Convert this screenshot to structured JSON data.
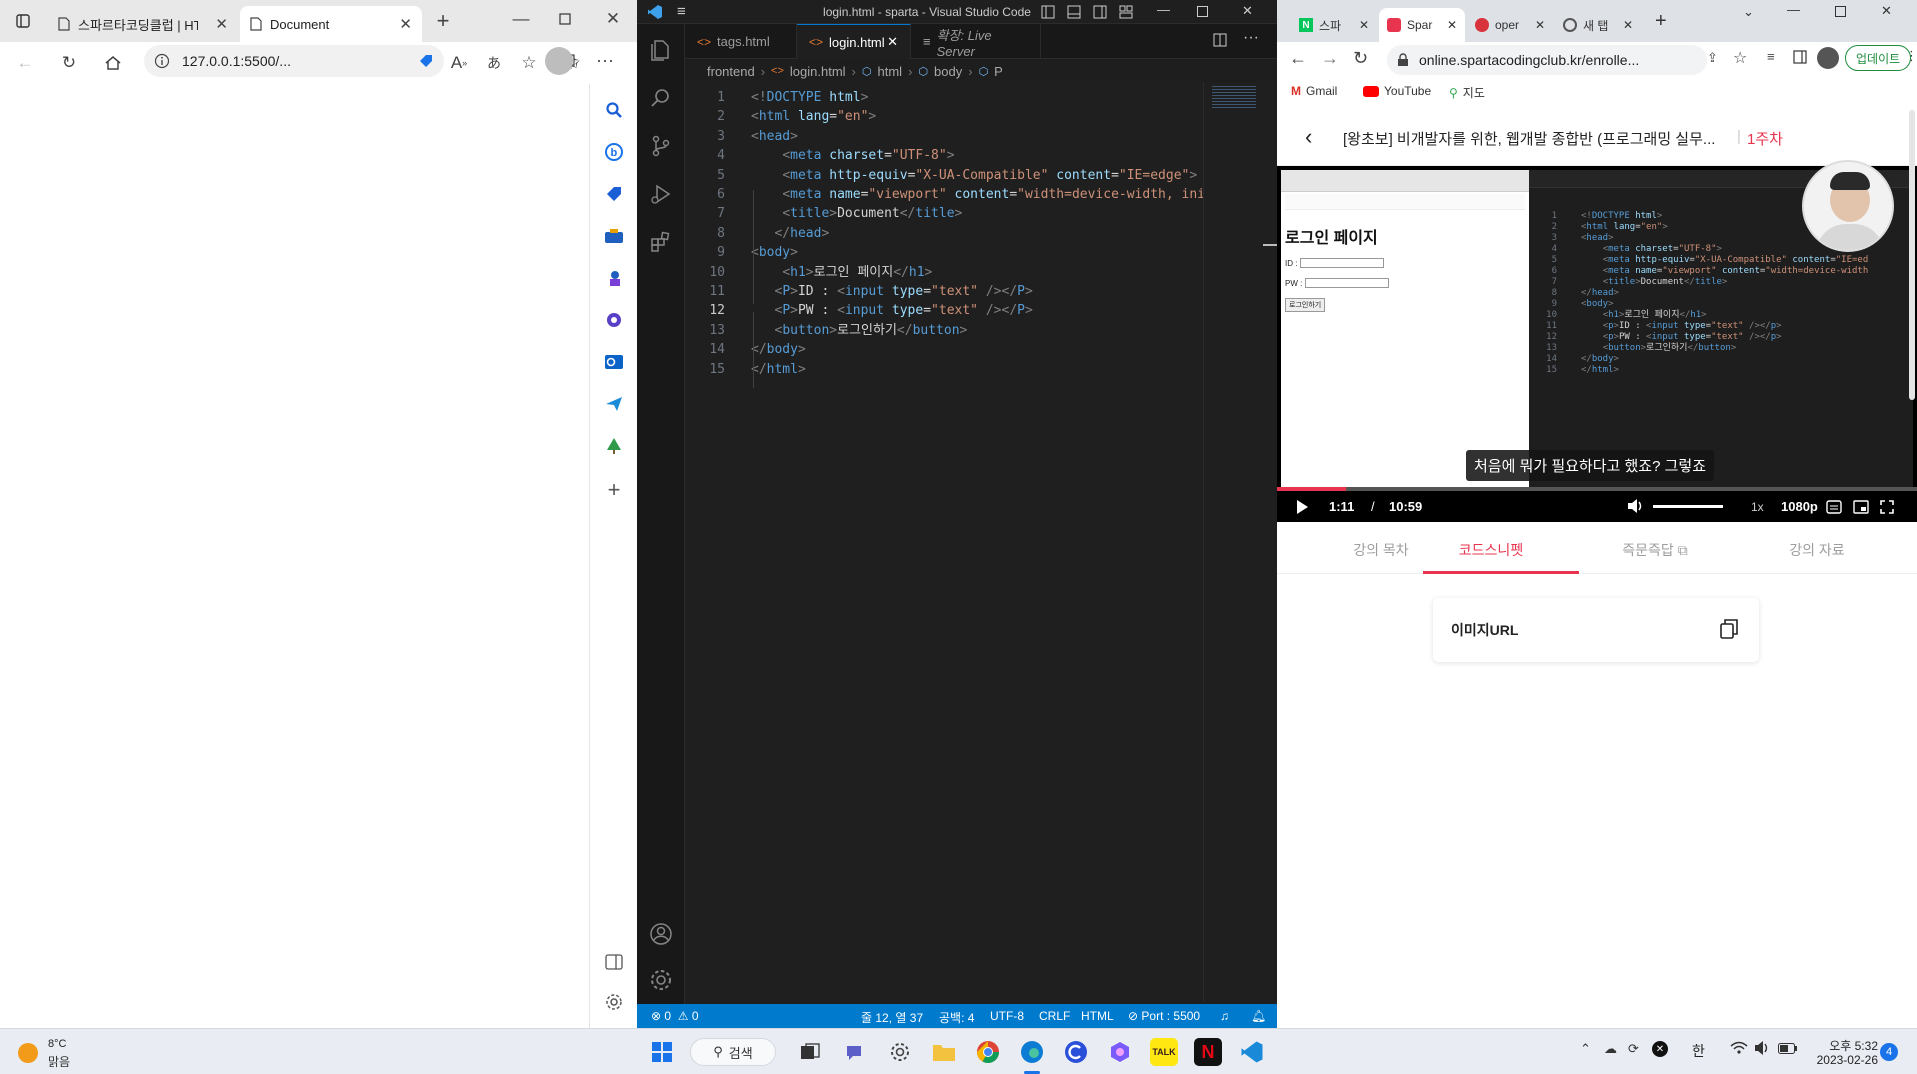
{
  "edge": {
    "tabs": [
      {
        "title": "스파르타코딩클럽 | HT"
      },
      {
        "title": "Document"
      }
    ],
    "address": "127.0.0.1:5500/..."
  },
  "vscode": {
    "title": "login.html - sparta - Visual Studio Code",
    "tabs": [
      {
        "label": "tags.html"
      },
      {
        "label": "login.html"
      },
      {
        "label": "확장: Live Server"
      }
    ],
    "breadcrumb": [
      "frontend",
      "login.html",
      "html",
      "body",
      "P"
    ],
    "current_line": 12,
    "code": [
      [
        {
          "c": "t-pun",
          "t": "<!"
        },
        {
          "c": "t-tag",
          "t": "DOCTYPE"
        },
        {
          "c": "t-txt",
          "t": " "
        },
        {
          "c": "t-attr",
          "t": "html"
        },
        {
          "c": "t-pun",
          "t": ">"
        }
      ],
      [
        {
          "c": "t-pun",
          "t": "<"
        },
        {
          "c": "t-tag",
          "t": "html"
        },
        {
          "c": "t-txt",
          "t": " "
        },
        {
          "c": "t-attr",
          "t": "lang"
        },
        {
          "c": "t-txt",
          "t": "="
        },
        {
          "c": "t-str",
          "t": "\"en\""
        },
        {
          "c": "t-pun",
          "t": ">"
        }
      ],
      [
        {
          "c": "t-pun",
          "t": "<"
        },
        {
          "c": "t-tag",
          "t": "head"
        },
        {
          "c": "t-pun",
          "t": ">"
        }
      ],
      [
        {
          "c": "t-txt",
          "t": "    "
        },
        {
          "c": "t-pun",
          "t": "<"
        },
        {
          "c": "t-tag",
          "t": "meta"
        },
        {
          "c": "t-txt",
          "t": " "
        },
        {
          "c": "t-attr",
          "t": "charset"
        },
        {
          "c": "t-txt",
          "t": "="
        },
        {
          "c": "t-str",
          "t": "\"UTF-8\""
        },
        {
          "c": "t-pun",
          "t": ">"
        }
      ],
      [
        {
          "c": "t-txt",
          "t": "    "
        },
        {
          "c": "t-pun",
          "t": "<"
        },
        {
          "c": "t-tag",
          "t": "meta"
        },
        {
          "c": "t-txt",
          "t": " "
        },
        {
          "c": "t-attr",
          "t": "http-equiv"
        },
        {
          "c": "t-txt",
          "t": "="
        },
        {
          "c": "t-str",
          "t": "\"X-UA-Compatible\""
        },
        {
          "c": "t-txt",
          "t": " "
        },
        {
          "c": "t-attr",
          "t": "content"
        },
        {
          "c": "t-txt",
          "t": "="
        },
        {
          "c": "t-str",
          "t": "\"IE=edge\""
        },
        {
          "c": "t-pun",
          "t": ">"
        }
      ],
      [
        {
          "c": "t-txt",
          "t": "    "
        },
        {
          "c": "t-pun",
          "t": "<"
        },
        {
          "c": "t-tag",
          "t": "meta"
        },
        {
          "c": "t-txt",
          "t": " "
        },
        {
          "c": "t-attr",
          "t": "name"
        },
        {
          "c": "t-txt",
          "t": "="
        },
        {
          "c": "t-str",
          "t": "\"viewport\""
        },
        {
          "c": "t-txt",
          "t": " "
        },
        {
          "c": "t-attr",
          "t": "content"
        },
        {
          "c": "t-txt",
          "t": "="
        },
        {
          "c": "t-str",
          "t": "\"width=device-width, ini"
        }
      ],
      [
        {
          "c": "t-txt",
          "t": "    "
        },
        {
          "c": "t-pun",
          "t": "<"
        },
        {
          "c": "t-tag",
          "t": "title"
        },
        {
          "c": "t-pun",
          "t": ">"
        },
        {
          "c": "t-txt",
          "t": "Document"
        },
        {
          "c": "t-pun",
          "t": "</"
        },
        {
          "c": "t-tag",
          "t": "title"
        },
        {
          "c": "t-pun",
          "t": ">"
        }
      ],
      [
        {
          "c": "t-txt",
          "t": "   "
        },
        {
          "c": "t-pun",
          "t": "</"
        },
        {
          "c": "t-tag",
          "t": "head"
        },
        {
          "c": "t-pun",
          "t": ">"
        }
      ],
      [
        {
          "c": "t-pun",
          "t": "<"
        },
        {
          "c": "t-tag",
          "t": "body"
        },
        {
          "c": "t-pun",
          "t": ">"
        }
      ],
      [
        {
          "c": "t-txt",
          "t": "    "
        },
        {
          "c": "t-pun",
          "t": "<"
        },
        {
          "c": "t-tag",
          "t": "h1"
        },
        {
          "c": "t-pun",
          "t": ">"
        },
        {
          "c": "t-txt",
          "t": "로그인 페이지"
        },
        {
          "c": "t-pun",
          "t": "</"
        },
        {
          "c": "t-tag",
          "t": "h1"
        },
        {
          "c": "t-pun",
          "t": ">"
        }
      ],
      [
        {
          "c": "t-txt",
          "t": "   "
        },
        {
          "c": "t-pun",
          "t": "<"
        },
        {
          "c": "t-tag",
          "t": "P"
        },
        {
          "c": "t-pun",
          "t": ">"
        },
        {
          "c": "t-txt",
          "t": "ID : "
        },
        {
          "c": "t-pun",
          "t": "<"
        },
        {
          "c": "t-tag",
          "t": "input"
        },
        {
          "c": "t-txt",
          "t": " "
        },
        {
          "c": "t-attr",
          "t": "type"
        },
        {
          "c": "t-txt",
          "t": "="
        },
        {
          "c": "t-str",
          "t": "\"text\""
        },
        {
          "c": "t-txt",
          "t": " "
        },
        {
          "c": "t-pun",
          "t": "/></"
        },
        {
          "c": "t-tag",
          "t": "P"
        },
        {
          "c": "t-pun",
          "t": ">"
        }
      ],
      [
        {
          "c": "t-txt",
          "t": "   "
        },
        {
          "c": "t-pun",
          "t": "<"
        },
        {
          "c": "t-tag",
          "t": "P"
        },
        {
          "c": "t-pun",
          "t": ">"
        },
        {
          "c": "t-txt",
          "t": "PW : "
        },
        {
          "c": "t-pun",
          "t": "<"
        },
        {
          "c": "t-tag",
          "t": "input"
        },
        {
          "c": "t-txt",
          "t": " "
        },
        {
          "c": "t-attr",
          "t": "type"
        },
        {
          "c": "t-txt",
          "t": "="
        },
        {
          "c": "t-str",
          "t": "\"text\""
        },
        {
          "c": "t-txt",
          "t": " "
        },
        {
          "c": "t-pun",
          "t": "/></"
        },
        {
          "c": "t-tag",
          "t": "P"
        },
        {
          "c": "t-pun",
          "t": ">"
        }
      ],
      [
        {
          "c": "t-txt",
          "t": "   "
        },
        {
          "c": "t-pun",
          "t": "<"
        },
        {
          "c": "t-tag",
          "t": "button"
        },
        {
          "c": "t-pun",
          "t": ">"
        },
        {
          "c": "t-txt",
          "t": "로그인하기"
        },
        {
          "c": "t-pun",
          "t": "</"
        },
        {
          "c": "t-tag",
          "t": "button"
        },
        {
          "c": "t-pun",
          "t": ">"
        }
      ],
      [
        {
          "c": "t-pun",
          "t": "</"
        },
        {
          "c": "t-tag",
          "t": "body"
        },
        {
          "c": "t-pun",
          "t": ">"
        }
      ],
      [
        {
          "c": "t-pun",
          "t": "</"
        },
        {
          "c": "t-tag",
          "t": "html"
        },
        {
          "c": "t-pun",
          "t": ">"
        }
      ]
    ],
    "status": {
      "errors": "0",
      "warnings": "0",
      "position": "줄 12, 열 37",
      "spaces": "공백: 4",
      "encoding": "UTF-8",
      "eol": "CRLF",
      "language": "HTML",
      "port": "Port : 5500"
    }
  },
  "chrome": {
    "tabs": [
      {
        "title": "스파"
      },
      {
        "title": "Spar"
      },
      {
        "title": "oper"
      },
      {
        "title": "새 탭"
      }
    ],
    "address": "online.spartacodingclub.kr/enrolle...",
    "update_label": "업데이트",
    "bookmarks": [
      {
        "label": "Gmail"
      },
      {
        "label": "YouTube"
      },
      {
        "label": "지도"
      }
    ],
    "course_title": "[왕초보] 비개발자를 위한, 웹개발 종합반 (프로그래밍 실무...",
    "week_label": "1주차",
    "video": {
      "page_heading": "로그인 페이지",
      "id_label": "ID :",
      "pw_label": "PW :",
      "button_label": "로그인하기",
      "subtitle": "처음에 뭐가 필요하다고 했죠? 그렇죠",
      "current_time": "1:11",
      "separator": "/",
      "duration": "10:59",
      "progress": 0.108,
      "speed": "1x",
      "quality": "1080p",
      "code": [
        [
          {
            "c": "t-pun",
            "t": "<!"
          },
          {
            "c": "t-tag",
            "t": "DOCTYPE"
          },
          {
            "c": "t-txt",
            "t": " "
          },
          {
            "c": "t-attr",
            "t": "html"
          },
          {
            "c": "t-pun",
            "t": ">"
          }
        ],
        [
          {
            "c": "t-pun",
            "t": "<"
          },
          {
            "c": "t-tag",
            "t": "html"
          },
          {
            "c": "t-txt",
            "t": " "
          },
          {
            "c": "t-attr",
            "t": "lang"
          },
          {
            "c": "t-txt",
            "t": "="
          },
          {
            "c": "t-str",
            "t": "\"en\""
          },
          {
            "c": "t-pun",
            "t": ">"
          }
        ],
        [
          {
            "c": "t-pun",
            "t": "<"
          },
          {
            "c": "t-tag",
            "t": "head"
          },
          {
            "c": "t-pun",
            "t": ">"
          }
        ],
        [
          {
            "c": "t-txt",
            "t": "    "
          },
          {
            "c": "t-pun",
            "t": "<"
          },
          {
            "c": "t-tag",
            "t": "meta"
          },
          {
            "c": "t-txt",
            "t": " "
          },
          {
            "c": "t-attr",
            "t": "charset"
          },
          {
            "c": "t-txt",
            "t": "="
          },
          {
            "c": "t-str",
            "t": "\"UTF-8\""
          },
          {
            "c": "t-pun",
            "t": ">"
          }
        ],
        [
          {
            "c": "t-txt",
            "t": "    "
          },
          {
            "c": "t-pun",
            "t": "<"
          },
          {
            "c": "t-tag",
            "t": "meta"
          },
          {
            "c": "t-txt",
            "t": " "
          },
          {
            "c": "t-attr",
            "t": "http-equiv"
          },
          {
            "c": "t-txt",
            "t": "="
          },
          {
            "c": "t-str",
            "t": "\"X-UA-Compatible\""
          },
          {
            "c": "t-txt",
            "t": " "
          },
          {
            "c": "t-attr",
            "t": "content"
          },
          {
            "c": "t-txt",
            "t": "="
          },
          {
            "c": "t-str",
            "t": "\"IE=ed"
          }
        ],
        [
          {
            "c": "t-txt",
            "t": "    "
          },
          {
            "c": "t-pun",
            "t": "<"
          },
          {
            "c": "t-tag",
            "t": "meta"
          },
          {
            "c": "t-txt",
            "t": " "
          },
          {
            "c": "t-attr",
            "t": "name"
          },
          {
            "c": "t-txt",
            "t": "="
          },
          {
            "c": "t-str",
            "t": "\"viewport\""
          },
          {
            "c": "t-txt",
            "t": " "
          },
          {
            "c": "t-attr",
            "t": "content"
          },
          {
            "c": "t-txt",
            "t": "="
          },
          {
            "c": "t-str",
            "t": "\"width=device-width"
          }
        ],
        [
          {
            "c": "t-txt",
            "t": "    "
          },
          {
            "c": "t-pun",
            "t": "<"
          },
          {
            "c": "t-tag",
            "t": "title"
          },
          {
            "c": "t-pun",
            "t": ">"
          },
          {
            "c": "t-txt",
            "t": "Document"
          },
          {
            "c": "t-pun",
            "t": "</"
          },
          {
            "c": "t-tag",
            "t": "title"
          },
          {
            "c": "t-pun",
            "t": ">"
          }
        ],
        [
          {
            "c": "t-pun",
            "t": "</"
          },
          {
            "c": "t-tag",
            "t": "head"
          },
          {
            "c": "t-pun",
            "t": ">"
          }
        ],
        [
          {
            "c": "t-pun",
            "t": "<"
          },
          {
            "c": "t-tag",
            "t": "body"
          },
          {
            "c": "t-pun",
            "t": ">"
          }
        ],
        [
          {
            "c": "t-txt",
            "t": "    "
          },
          {
            "c": "t-pun",
            "t": "<"
          },
          {
            "c": "t-tag",
            "t": "h1"
          },
          {
            "c": "t-pun",
            "t": ">"
          },
          {
            "c": "t-txt",
            "t": "로그인 페이지"
          },
          {
            "c": "t-pun",
            "t": "</"
          },
          {
            "c": "t-tag",
            "t": "h1"
          },
          {
            "c": "t-pun",
            "t": ">"
          }
        ],
        [
          {
            "c": "t-txt",
            "t": "    "
          },
          {
            "c": "t-pun",
            "t": "<"
          },
          {
            "c": "t-tag",
            "t": "p"
          },
          {
            "c": "t-pun",
            "t": ">"
          },
          {
            "c": "t-txt",
            "t": "ID : "
          },
          {
            "c": "t-pun",
            "t": "<"
          },
          {
            "c": "t-tag",
            "t": "input"
          },
          {
            "c": "t-txt",
            "t": " "
          },
          {
            "c": "t-attr",
            "t": "type"
          },
          {
            "c": "t-txt",
            "t": "="
          },
          {
            "c": "t-str",
            "t": "\"text\""
          },
          {
            "c": "t-txt",
            "t": " "
          },
          {
            "c": "t-pun",
            "t": "/></"
          },
          {
            "c": "t-tag",
            "t": "p"
          },
          {
            "c": "t-pun",
            "t": ">"
          }
        ],
        [
          {
            "c": "t-txt",
            "t": "    "
          },
          {
            "c": "t-pun",
            "t": "<"
          },
          {
            "c": "t-tag",
            "t": "p"
          },
          {
            "c": "t-pun",
            "t": ">"
          },
          {
            "c": "t-txt",
            "t": "PW : "
          },
          {
            "c": "t-pun",
            "t": "<"
          },
          {
            "c": "t-tag",
            "t": "input"
          },
          {
            "c": "t-txt",
            "t": " "
          },
          {
            "c": "t-attr",
            "t": "type"
          },
          {
            "c": "t-txt",
            "t": "="
          },
          {
            "c": "t-str",
            "t": "\"text\""
          },
          {
            "c": "t-txt",
            "t": " "
          },
          {
            "c": "t-pun",
            "t": "/></"
          },
          {
            "c": "t-tag",
            "t": "p"
          },
          {
            "c": "t-pun",
            "t": ">"
          }
        ],
        [
          {
            "c": "t-txt",
            "t": "    "
          },
          {
            "c": "t-pun",
            "t": "<"
          },
          {
            "c": "t-tag",
            "t": "button"
          },
          {
            "c": "t-pun",
            "t": ">"
          },
          {
            "c": "t-txt",
            "t": "로그인하기"
          },
          {
            "c": "t-pun",
            "t": "</"
          },
          {
            "c": "t-tag",
            "t": "button"
          },
          {
            "c": "t-pun",
            "t": ">"
          }
        ],
        [
          {
            "c": "t-pun",
            "t": "</"
          },
          {
            "c": "t-tag",
            "t": "body"
          },
          {
            "c": "t-pun",
            "t": ">"
          }
        ],
        [
          {
            "c": "t-pun",
            "t": "</"
          },
          {
            "c": "t-tag",
            "t": "html"
          },
          {
            "c": "t-pun",
            "t": ">"
          }
        ]
      ]
    },
    "course_tabs": [
      {
        "label": "강의 목차"
      },
      {
        "label": "코드스니펫"
      },
      {
        "label": "즉문즉답"
      },
      {
        "label": "강의 자료"
      }
    ],
    "snippet_label": "이미지URL"
  },
  "taskbar": {
    "weather_temp": "8°C",
    "weather_desc": "맑음",
    "search_label": "검색",
    "ime": "한",
    "time": "오후 5:32",
    "date": "2023-02-26",
    "notification_count": "4"
  }
}
